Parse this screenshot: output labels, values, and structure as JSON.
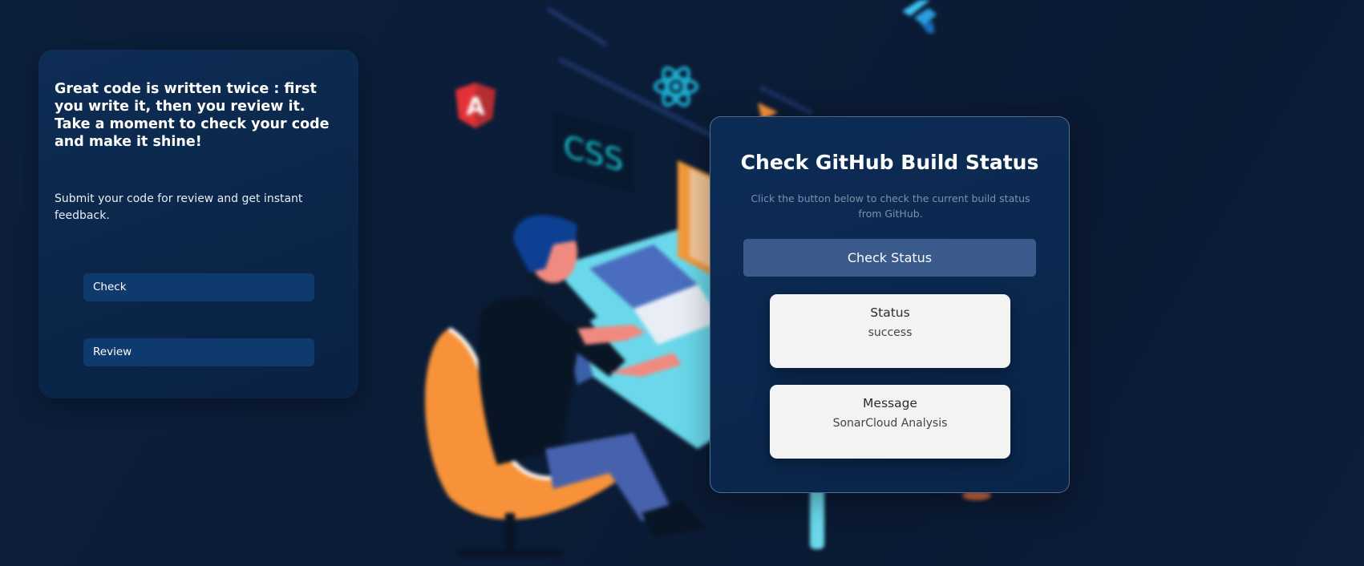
{
  "left_panel": {
    "quote": "Great code is written twice : first you write it, then you review it. Take a moment to check your code and make it shine!",
    "subtitle": "Submit your code for review and get instant feedback.",
    "buttons": {
      "check": "Check",
      "review": "Review"
    }
  },
  "status_panel": {
    "title": "Check GitHub Build Status",
    "description": "Click the button below to check the current build status from GitHub.",
    "check_button": "Check Status",
    "status": {
      "label": "Status",
      "value": "success"
    },
    "message": {
      "label": "Message",
      "value": "SonarCloud Analysis"
    }
  },
  "illustration": {
    "css_sign": "CSS",
    "angular_letter": "A"
  },
  "colors": {
    "background": "#0b1c36",
    "card": "#0b2649",
    "button": "#0f3a6e",
    "status_button": "#3a5a8c",
    "info_box": "#f3f3f3",
    "accent_orange": "#f7923a",
    "accent_cyan": "#7fe8f5"
  }
}
